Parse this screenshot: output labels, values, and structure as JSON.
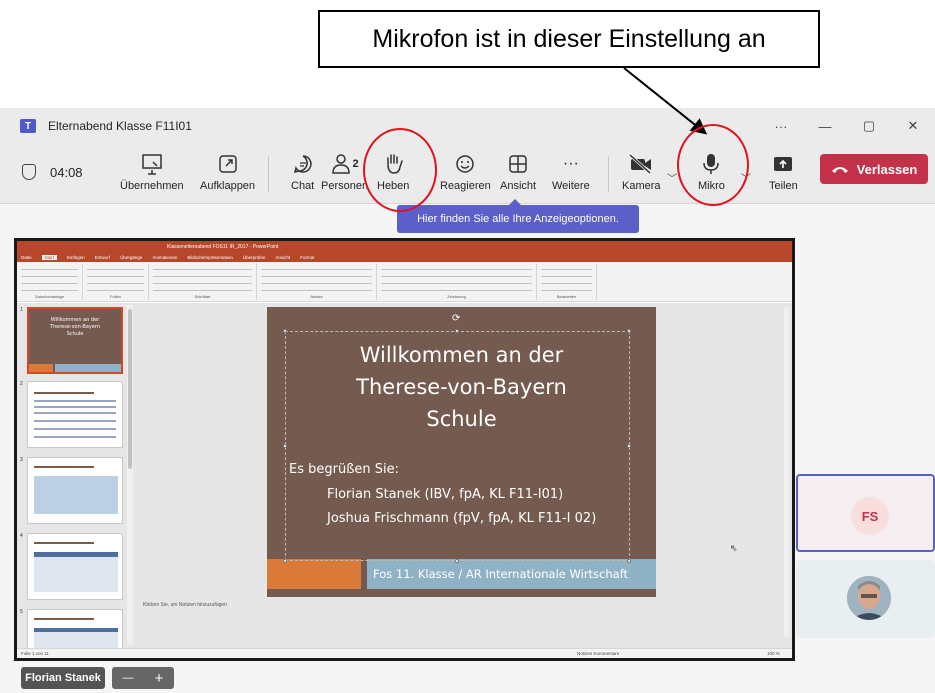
{
  "callout": {
    "text": "Mikrofon ist in dieser Einstellung an"
  },
  "window": {
    "title": "Elternabend Klasse F11I01",
    "more": "···",
    "minimize": "—",
    "maximize": "▢",
    "close": "✕"
  },
  "toolbar": {
    "timer": "04:08",
    "buttons": {
      "uebernehmen": "Übernehmen",
      "aufklappen": "Aufklappen",
      "chat": "Chat",
      "personen": "Personen",
      "personen_count": "2",
      "heben": "Heben",
      "reagieren": "Reagieren",
      "ansicht": "Ansicht",
      "weitere": "Weitere",
      "kamera": "Kamera",
      "mikro": "Mikro",
      "teilen": "Teilen"
    },
    "leave": "Verlassen"
  },
  "tooltip": "Hier finden Sie alle Ihre Anzeigeoptionen.",
  "ppt": {
    "tabs": [
      "Datei",
      "Start",
      "Einfügen",
      "Entwurf",
      "Übergänge",
      "Animationen",
      "Bildschirmpräsentation",
      "Überprüfen",
      "Ansicht",
      "Format"
    ],
    "active_tab": "Start",
    "titlebar": "Klassenelternabend FOS11 IR_2017 - PowerPoint",
    "ribbon_groups": [
      "Zwischenablage",
      "Folien",
      "Schriftart",
      "Absatz",
      "Zeichnung",
      "Bearbeiten"
    ],
    "thumbnails": [
      "1",
      "2",
      "3",
      "4",
      "5"
    ],
    "slide": {
      "title_lines": [
        "Willkommen an der",
        "Therese-von-Bayern",
        "Schule"
      ],
      "greeting": "Es begrüßen Sie:",
      "name1": "Florian Stanek (IBV, fpA, KL F11-I01)",
      "name2": "Joshua Frischmann (fpV, fpA, KL F11-I 02)",
      "footer": "Fos 11. Klasse / AR Internationale Wirtschaft"
    },
    "notes": "Klicken Sie, um Notizen hinzuzufügen",
    "status_left": "Folie 1 von 11",
    "status_right": "Notizen   Kommentare",
    "zoom": "100 %"
  },
  "participants": [
    {
      "initials": "FS"
    },
    {
      "initials": ""
    }
  ],
  "bottom": {
    "name": "Florian Stanek",
    "minus": "—",
    "plus": "+"
  }
}
